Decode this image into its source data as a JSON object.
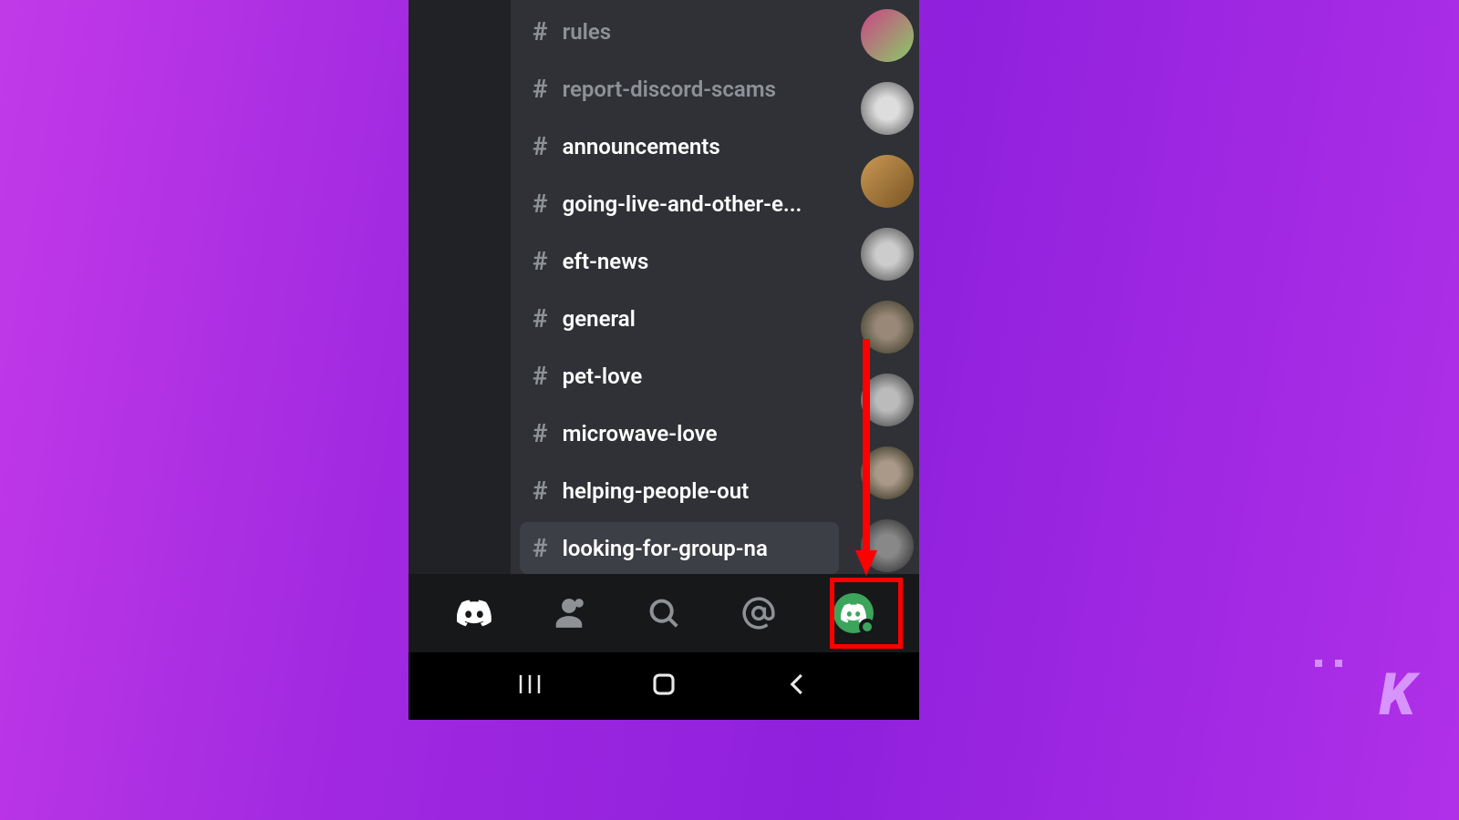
{
  "channels": [
    {
      "name": "rules",
      "unread": false,
      "muted": true,
      "selected": false
    },
    {
      "name": "report-discord-scams",
      "unread": false,
      "muted": true,
      "selected": false
    },
    {
      "name": "announcements",
      "unread": true,
      "muted": false,
      "selected": false
    },
    {
      "name": "going-live-and-other-e...",
      "unread": true,
      "muted": false,
      "selected": false
    },
    {
      "name": "eft-news",
      "unread": true,
      "muted": false,
      "selected": false
    },
    {
      "name": "general",
      "unread": true,
      "muted": false,
      "selected": false
    },
    {
      "name": "pet-love",
      "unread": true,
      "muted": false,
      "selected": false
    },
    {
      "name": "microwave-love",
      "unread": true,
      "muted": false,
      "selected": false
    },
    {
      "name": "helping-people-out",
      "unread": true,
      "muted": false,
      "selected": false
    },
    {
      "name": "looking-for-group-na",
      "unread": true,
      "muted": false,
      "selected": true
    }
  ],
  "member_avatars": [
    {
      "bg": "linear-gradient(135deg,#c48 0%,#8c6 100%)"
    },
    {
      "bg": "radial-gradient(circle,#ddd 30%,#555 100%)"
    },
    {
      "bg": "linear-gradient(135deg,#cc9955 0%,#775522 100%)"
    },
    {
      "bg": "radial-gradient(circle,#ccc 30%,#444 100%)"
    },
    {
      "bg": "radial-gradient(circle,#998877 30%,#332 100%)"
    },
    {
      "bg": "radial-gradient(circle,#bbb 30%,#333 100%)"
    },
    {
      "bg": "radial-gradient(circle,#aa9988 30%,#221 100%)"
    },
    {
      "bg": "radial-gradient(circle,#888 30%,#222 100%)"
    }
  ],
  "nav": {
    "discord": "discord-logo",
    "friends": "friends-icon",
    "search": "search-icon",
    "mentions": "mentions-icon",
    "profile": "profile-avatar"
  },
  "highlight": {
    "target": "profile-avatar"
  },
  "watermark": "K"
}
